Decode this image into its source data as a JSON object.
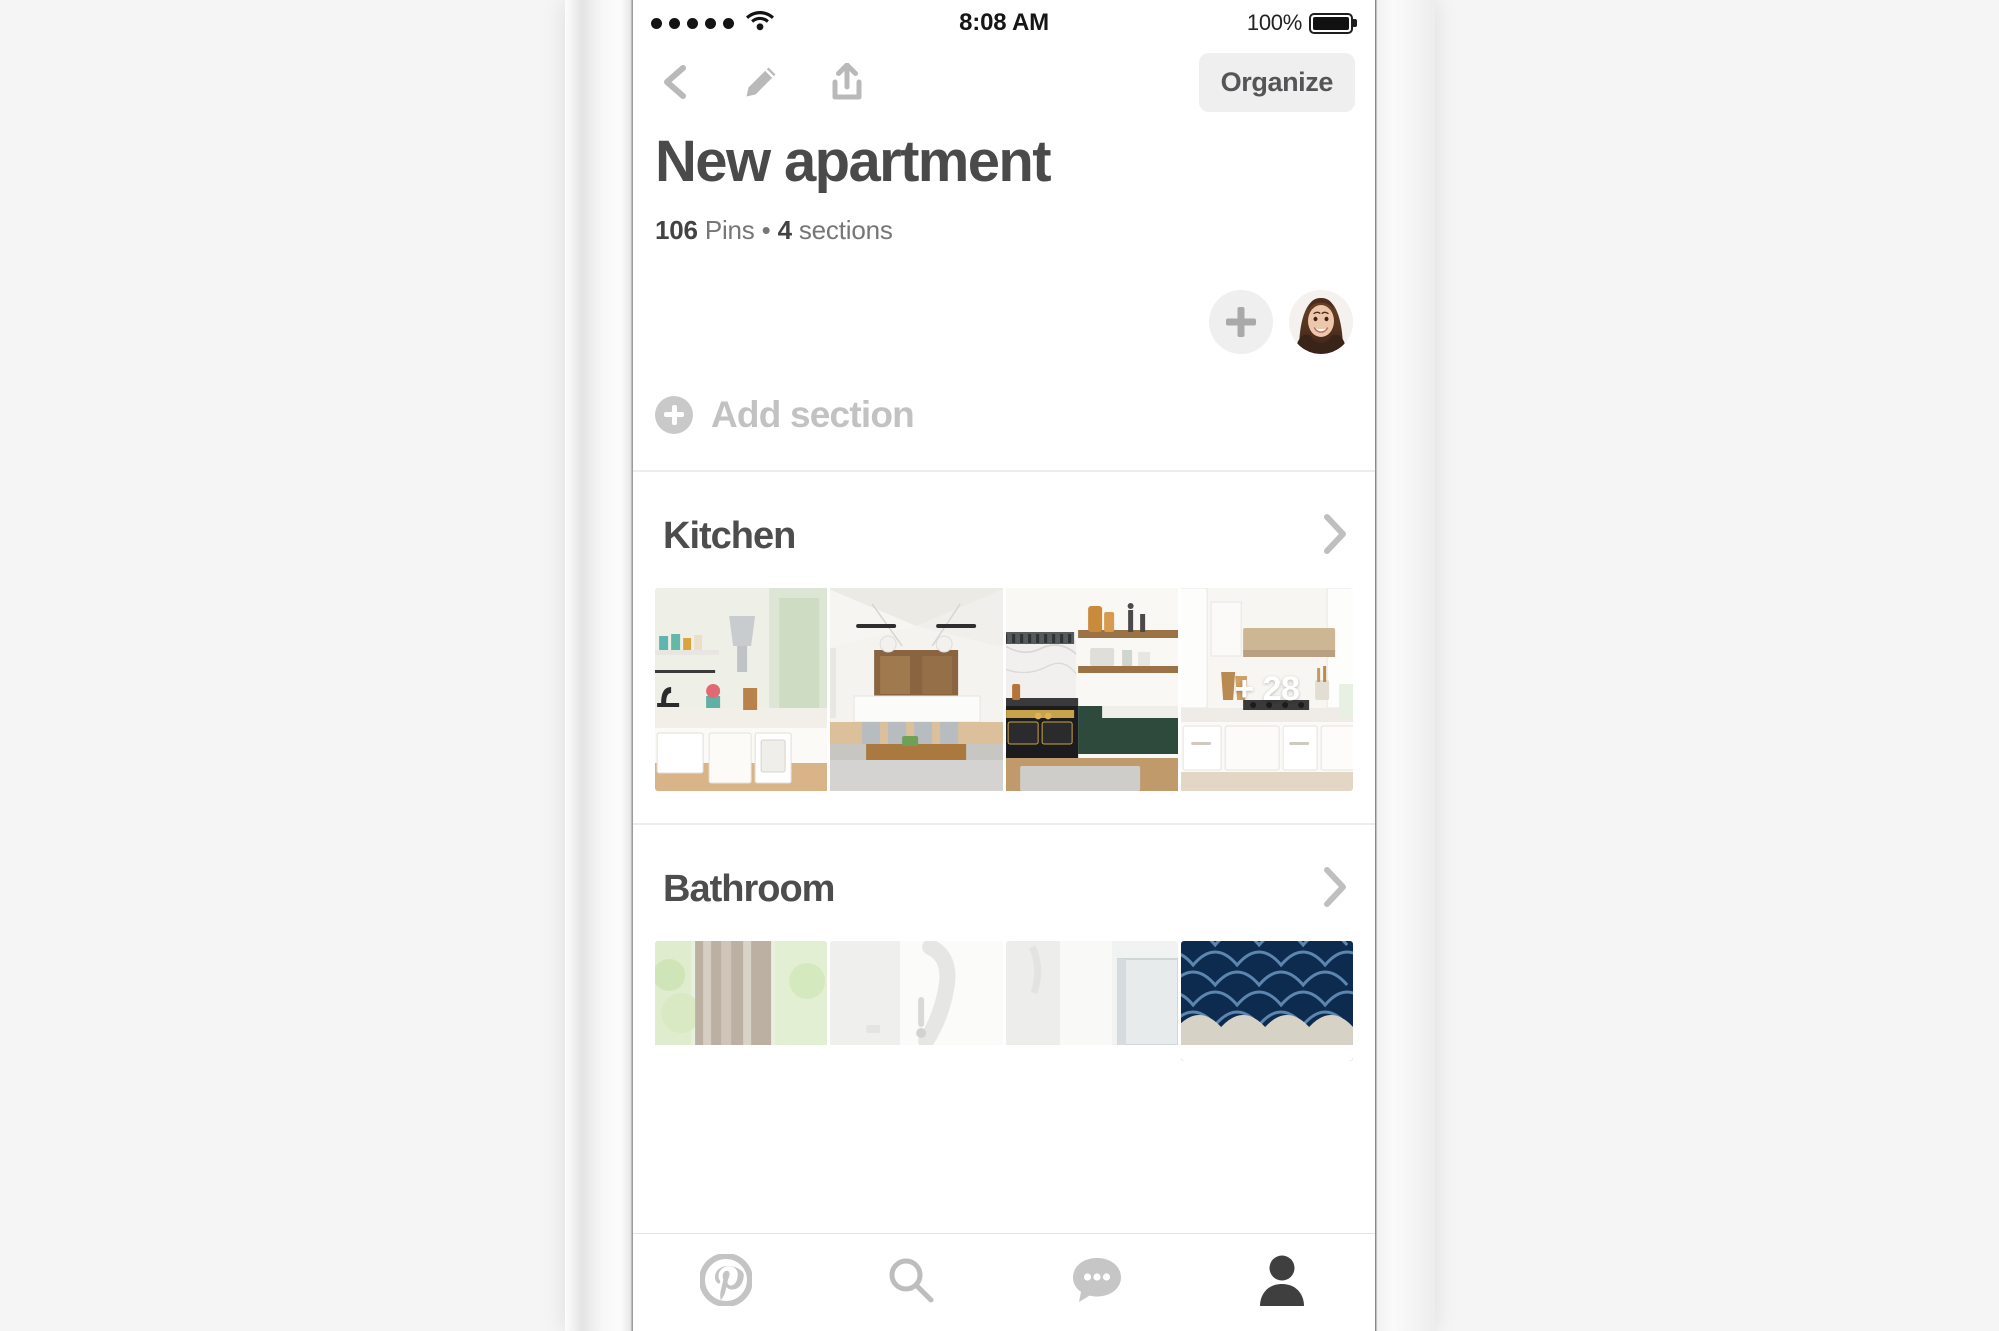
{
  "status_bar": {
    "signal_dots": 5,
    "wifi_icon": "wifi-icon",
    "time": "8:08 AM",
    "battery_percent": "100%",
    "battery_icon": "battery-full-icon"
  },
  "toolbar": {
    "back_icon": "chevron-left-icon",
    "edit_icon": "pencil-icon",
    "share_icon": "share-upload-icon",
    "organize_label": "Organize"
  },
  "board": {
    "title": "New apartment",
    "pins_count": "106",
    "pins_word": "Pins",
    "separator": "•",
    "sections_count": "4",
    "sections_word": "sections",
    "add_collaborator_icon": "plus-icon",
    "avatar_name": "user-avatar",
    "add_section_label": "Add section",
    "add_section_icon": "plus-circle-icon"
  },
  "sections": [
    {
      "name": "Kitchen",
      "chevron_icon": "chevron-right-icon",
      "thumbnails": [
        {
          "alt": "white-farmhouse-kitchen",
          "overlay": ""
        },
        {
          "alt": "open-plan-kitchen-island",
          "overlay": ""
        },
        {
          "alt": "marble-backsplash-green-cabinets",
          "overlay": ""
        },
        {
          "alt": "white-kitchen-range-hood",
          "overlay": "+ 28"
        }
      ]
    },
    {
      "name": "Bathroom",
      "chevron_icon": "chevron-right-icon",
      "thumbnails": [
        {
          "alt": "bathroom-green-window-view",
          "overlay": ""
        },
        {
          "alt": "white-shower-fixture",
          "overlay": ""
        },
        {
          "alt": "glass-shower-door",
          "overlay": ""
        },
        {
          "alt": "navy-scalloped-tile",
          "overlay": ""
        }
      ]
    }
  ],
  "tab_bar": {
    "tabs": [
      {
        "name": "home",
        "icon": "pinterest-logo-icon",
        "active": false
      },
      {
        "name": "search",
        "icon": "search-icon",
        "active": false
      },
      {
        "name": "messages",
        "icon": "chat-bubble-icon",
        "active": false
      },
      {
        "name": "profile",
        "icon": "person-icon",
        "active": true
      }
    ]
  },
  "colors": {
    "page_background": "#f5f5f5",
    "screen_background": "#ffffff",
    "title_text": "#4a4a4a",
    "muted_text": "#767676",
    "placeholder_gray": "#c2c2c2",
    "chip_background": "#efefef",
    "active_tab": "#3d3d3d",
    "inactive_tab": "#c4c4c4"
  }
}
